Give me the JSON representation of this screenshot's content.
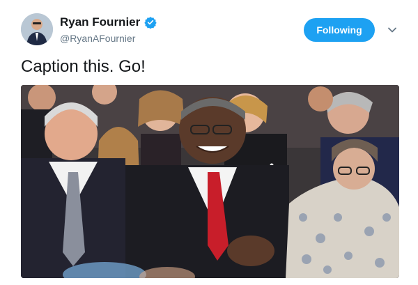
{
  "user": {
    "name": "Ryan Fournier",
    "handle": "@RyanAFournier",
    "verified": true
  },
  "follow_button": {
    "label": "Following"
  },
  "tweet": {
    "text": "Caption this. Go!"
  },
  "colors": {
    "accent": "#1da1f2",
    "text": "#14171a",
    "muted": "#657786"
  },
  "icons": {
    "verified": "verified-badge-icon",
    "menu": "chevron-down-icon"
  }
}
